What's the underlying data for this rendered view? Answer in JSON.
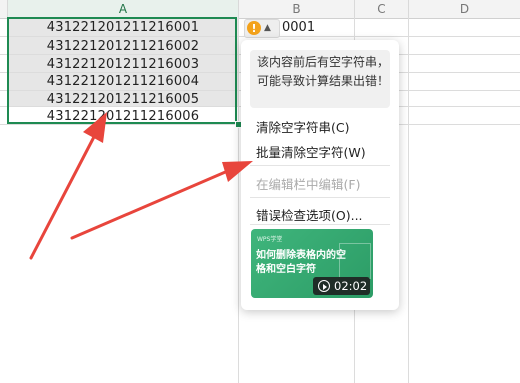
{
  "columns": [
    "A",
    "B",
    "C",
    "D"
  ],
  "cells_a": [
    "431221201211216001",
    "431221201211216002",
    "431221201211216003",
    "431221201211216004",
    "431221201211216005",
    "431221201211216006"
  ],
  "cell_b1": "0001",
  "error_button": {
    "warning_symbol": "!",
    "caret": "▲"
  },
  "menu": {
    "tip": "该内容前后有空字符串，可能导致计算结果出错！",
    "items": [
      "清除空字符串(C)",
      "批量清除空字符(W)",
      "在编辑栏中编辑(F)",
      "错误检查选项(O)..."
    ],
    "video": {
      "brand": "WPS学堂",
      "title": "如何删除表格内的空格和空白字符",
      "duration": "02:02"
    }
  },
  "colors": {
    "selection": "#1e8a52",
    "arrow": "#e8453c",
    "warning": "#f3a21b",
    "video": "#3fb57c"
  }
}
